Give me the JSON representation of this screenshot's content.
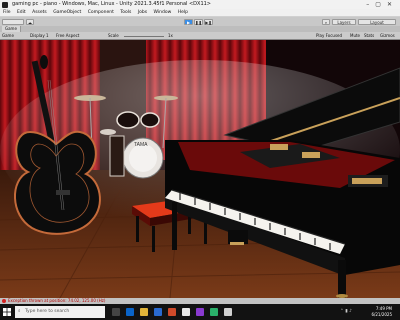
{
  "window": {
    "title": "gaming pc - piano - Windows, Mac, Linux - Unity 2021.3.45f1 Personal <DX11>"
  },
  "menu": [
    "File",
    "Edit",
    "Assets",
    "GameObject",
    "Component",
    "Tools",
    "Jobs",
    "Window",
    "Help"
  ],
  "toolbar": {
    "layers_label": "Layers",
    "layout_label": "Layout"
  },
  "tabs": {
    "game": "Game"
  },
  "gamebar": {
    "mode": "Game",
    "display": "Display 1",
    "aspect": "Free Aspect",
    "scale_label": "Scale",
    "scale_value": "1x",
    "play_focused": "Play Focused",
    "mute": "Mute",
    "stats": "Stats",
    "gizmos": "Gizmos"
  },
  "status": {
    "message": "Exception thrown at position: 74.02, 125.00 (Hz)"
  },
  "taskbar": {
    "search_placeholder": "Type here to search",
    "time": "7:49 PM",
    "date": "6/21/2025"
  },
  "colors": {
    "curtain": "#b01218",
    "floor": "#6b2e14",
    "piano": "#0a0a0a",
    "guitar_accent": "#c46a3a",
    "bench_cushion": "#e43a1a"
  }
}
